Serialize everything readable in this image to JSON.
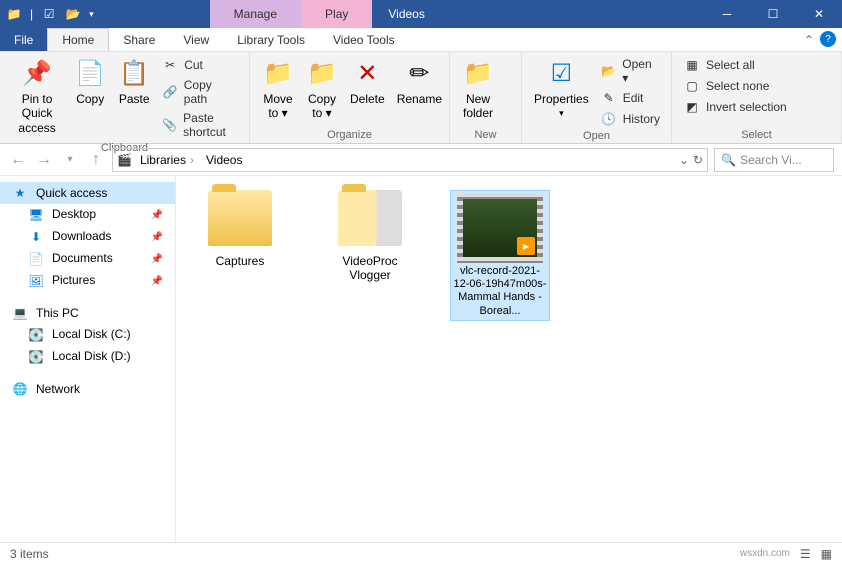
{
  "title": "Videos",
  "context_tabs": {
    "manage": "Manage",
    "play": "Play"
  },
  "tabs": {
    "file": "File",
    "home": "Home",
    "share": "Share",
    "view": "View",
    "library": "Library Tools",
    "video": "Video Tools"
  },
  "ribbon": {
    "clipboard": {
      "label": "Clipboard",
      "pin": "Pin to Quick\naccess",
      "copy": "Copy",
      "paste": "Paste",
      "cut": "Cut",
      "copy_path": "Copy path",
      "paste_shortcut": "Paste shortcut"
    },
    "organize": {
      "label": "Organize",
      "move": "Move\nto ▾",
      "copy": "Copy\nto ▾",
      "delete": "Delete",
      "rename": "Rename"
    },
    "new": {
      "label": "New",
      "new_folder": "New\nfolder"
    },
    "open": {
      "label": "Open",
      "properties": "Properties",
      "open": "Open ▾",
      "edit": "Edit",
      "history": "History"
    },
    "select": {
      "label": "Select",
      "all": "Select all",
      "none": "Select none",
      "invert": "Invert selection"
    }
  },
  "breadcrumb": {
    "libraries": "Libraries",
    "videos": "Videos"
  },
  "search": {
    "placeholder": "Search Vi..."
  },
  "sidebar": {
    "quick": "Quick access",
    "desktop": "Desktop",
    "downloads": "Downloads",
    "documents": "Documents",
    "pictures": "Pictures",
    "thispc": "This PC",
    "disk_c": "Local Disk (C:)",
    "disk_d": "Local Disk (D:)",
    "network": "Network"
  },
  "items": {
    "captures": "Captures",
    "videoproc": "VideoProc\nVlogger",
    "video_file": "vlc-record-2021-12-06-19h47m00s-Mammal Hands - Boreal..."
  },
  "status": {
    "count": "3 items",
    "watermark": "wsxdn.com"
  }
}
